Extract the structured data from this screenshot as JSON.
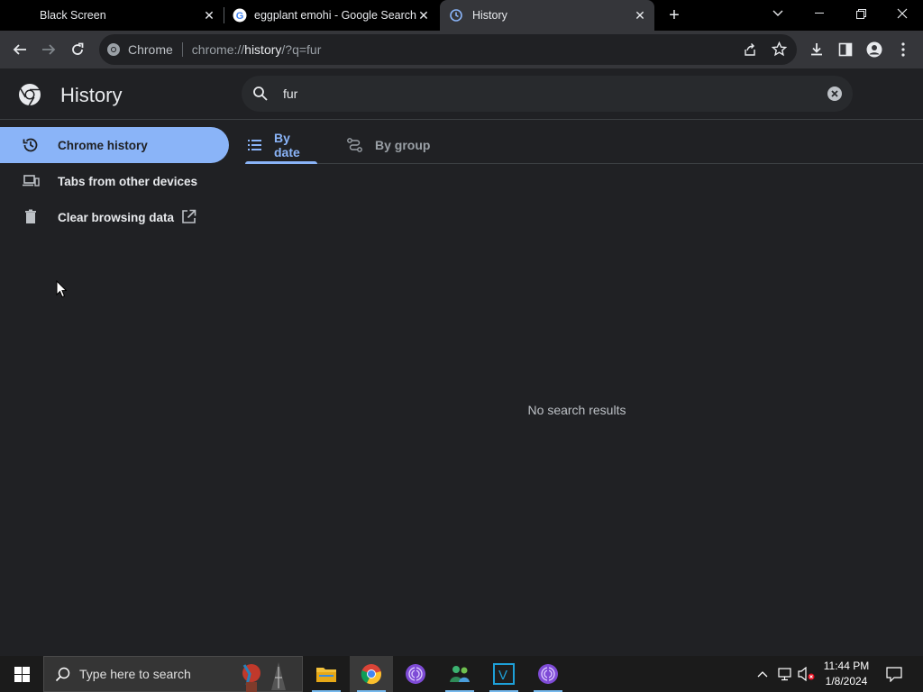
{
  "tabs": [
    {
      "title": "Black Screen",
      "active": false
    },
    {
      "title": "eggplant emohi - Google Search",
      "active": false
    },
    {
      "title": "History",
      "active": true
    }
  ],
  "toolbar": {
    "site_label": "Chrome",
    "url_prefix": "chrome://",
    "url_host": "history",
    "url_suffix": "/?q=fur"
  },
  "header": {
    "title": "History",
    "search_value": "fur"
  },
  "sidebar": {
    "items": [
      {
        "label": "Chrome history",
        "icon": "history-icon",
        "active": true
      },
      {
        "label": "Tabs from other devices",
        "icon": "devices-icon",
        "active": false
      },
      {
        "label": "Clear browsing data",
        "icon": "trash-icon",
        "active": false
      }
    ]
  },
  "subtabs": [
    {
      "label": "By date",
      "icon": "list-icon",
      "selected": true
    },
    {
      "label": "By group",
      "icon": "journeys-icon",
      "selected": false
    }
  ],
  "main": {
    "empty_message": "No search results"
  },
  "taskbar": {
    "search_placeholder": "Type here to search",
    "time": "11:44 PM",
    "date": "1/8/2024"
  },
  "colors": {
    "accent": "#8ab4f8",
    "background": "#202124",
    "toolbar": "#35363a",
    "tabstrip": "#000000"
  }
}
